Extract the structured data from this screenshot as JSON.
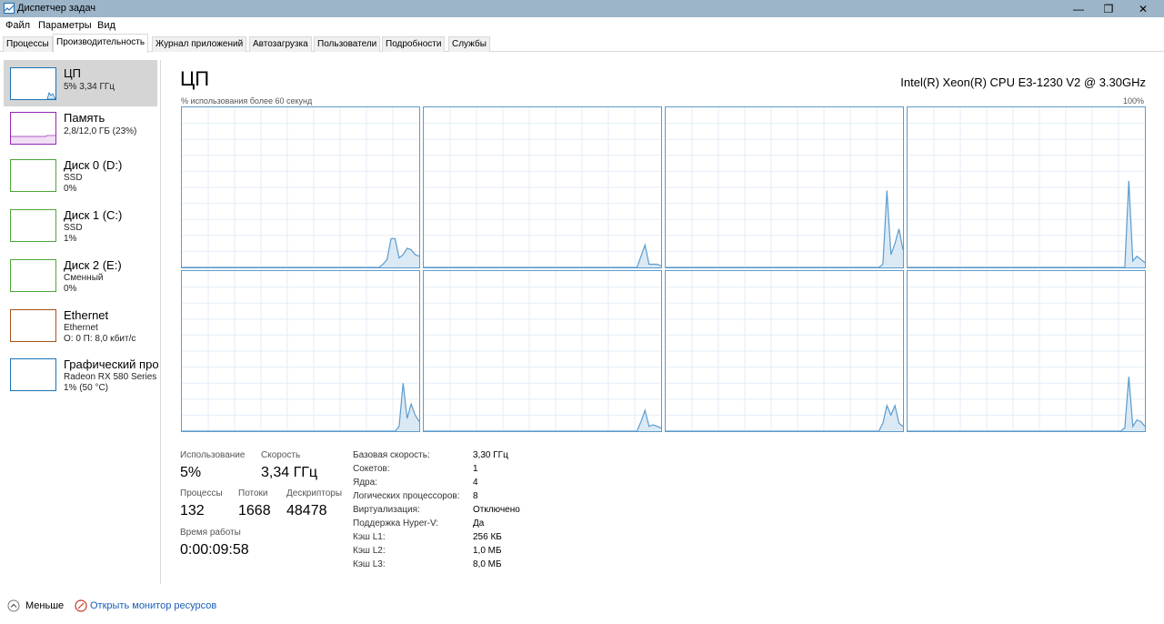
{
  "window": {
    "title": "Диспетчер задач",
    "minimize": "—",
    "maximize": "❐",
    "close": "✕"
  },
  "menu": [
    "Файл",
    "Параметры",
    "Вид"
  ],
  "tabs": [
    "Процессы",
    "Производительность",
    "Журнал приложений",
    "Автозагрузка",
    "Пользователи",
    "Подробности",
    "Службы"
  ],
  "active_tab": 1,
  "sidebar": [
    {
      "name": "ЦП",
      "sub1": "5% 3,34 ГГц",
      "sub2": "",
      "sub3": "",
      "color": "#1874b8",
      "sel": true
    },
    {
      "name": "Память",
      "sub1": "2,8/12,0 ГБ (23%)",
      "sub2": "",
      "sub3": "",
      "color": "#9528b4",
      "sel": false
    },
    {
      "name": "Диск 0 (D:)",
      "sub1": "SSD",
      "sub2": "0%",
      "sub3": "",
      "color": "#4ca637",
      "sel": false
    },
    {
      "name": "Диск 1 (C:)",
      "sub1": "SSD",
      "sub2": "1%",
      "sub3": "",
      "color": "#4ca637",
      "sel": false
    },
    {
      "name": "Диск 2 (E:)",
      "sub1": "Сменный",
      "sub2": "0%",
      "sub3": "",
      "color": "#4ca637",
      "sel": false
    },
    {
      "name": "Ethernet",
      "sub1": "Ethernet",
      "sub2": "О: 0 П: 8,0 кбит/с",
      "sub3": "",
      "color": "#a7541b",
      "sel": false
    },
    {
      "name": "Графический про",
      "sub1": "Radeon RX 580 Series",
      "sub2": "1% (50 °C)",
      "sub3": "",
      "color": "#1874b8",
      "sel": false
    }
  ],
  "main": {
    "title": "ЦП",
    "cpu_name": "Intel(R) Xeon(R) CPU E3-1230 V2 @ 3.30GHz",
    "graph_label": "% использования более 60 секунд",
    "graph_max": "100%",
    "line_color": "#5b9ccd",
    "fill_color": "#dbe9f5"
  },
  "stats": {
    "usage_label": "Использование",
    "usage": "5%",
    "speed_label": "Скорость",
    "speed": "3,34 ГГц",
    "proc_label": "Процессы",
    "proc": "132",
    "threads_label": "Потоки",
    "threads": "1668",
    "handles_label": "Дескрипторы",
    "handles": "48478",
    "uptime_label": "Время работы",
    "uptime": "0:00:09:58"
  },
  "details": [
    {
      "k": "Базовая скорость:",
      "v": "3,30 ГГц"
    },
    {
      "k": "Сокетов:",
      "v": "1"
    },
    {
      "k": "Ядра:",
      "v": "4"
    },
    {
      "k": "Логических процессоров:",
      "v": "8"
    },
    {
      "k": "Виртуализация:",
      "v": "Отключено"
    },
    {
      "k": "Поддержка Hyper-V:",
      "v": "Да"
    },
    {
      "k": "Кэш L1:",
      "v": "256 КБ"
    },
    {
      "k": "Кэш L2:",
      "v": "1,0 МБ"
    },
    {
      "k": "Кэш L3:",
      "v": "8,0 МБ"
    }
  ],
  "footer": {
    "less": "Меньше",
    "monitor": "Открыть монитор ресурсов"
  },
  "cores": [
    [
      0,
      0,
      0,
      0,
      0,
      0,
      0,
      0,
      0,
      0,
      0,
      0,
      0,
      0,
      0,
      0,
      0,
      0,
      0,
      0,
      0,
      0,
      0,
      0,
      0,
      0,
      0,
      0,
      0,
      0,
      0,
      0,
      0,
      0,
      0,
      0,
      0,
      0,
      0,
      0,
      0,
      0,
      0,
      0,
      0,
      0,
      0,
      0,
      0,
      0,
      2,
      5,
      18,
      18,
      6,
      8,
      12,
      11,
      8,
      7
    ],
    [
      0,
      0,
      0,
      0,
      0,
      0,
      0,
      0,
      0,
      0,
      0,
      0,
      0,
      0,
      0,
      0,
      0,
      0,
      0,
      0,
      0,
      0,
      0,
      0,
      0,
      0,
      0,
      0,
      0,
      0,
      0,
      0,
      0,
      0,
      0,
      0,
      0,
      0,
      0,
      0,
      0,
      0,
      0,
      0,
      0,
      0,
      0,
      0,
      0,
      0,
      0,
      0,
      0,
      0,
      7,
      14,
      2,
      2,
      2,
      1
    ],
    [
      0,
      0,
      0,
      0,
      0,
      0,
      0,
      0,
      0,
      0,
      0,
      0,
      0,
      0,
      0,
      0,
      0,
      0,
      0,
      0,
      0,
      0,
      0,
      0,
      0,
      0,
      0,
      0,
      0,
      0,
      0,
      0,
      0,
      0,
      0,
      0,
      0,
      0,
      0,
      0,
      0,
      0,
      0,
      0,
      0,
      0,
      0,
      0,
      0,
      0,
      0,
      0,
      0,
      0,
      2,
      48,
      8,
      15,
      24,
      11
    ],
    [
      0,
      0,
      0,
      0,
      0,
      0,
      0,
      0,
      0,
      0,
      0,
      0,
      0,
      0,
      0,
      0,
      0,
      0,
      0,
      0,
      0,
      0,
      0,
      0,
      0,
      0,
      0,
      0,
      0,
      0,
      0,
      0,
      0,
      0,
      0,
      0,
      0,
      0,
      0,
      0,
      0,
      0,
      0,
      0,
      0,
      0,
      0,
      0,
      0,
      0,
      0,
      0,
      0,
      0,
      0,
      54,
      4,
      7,
      5,
      3
    ],
    [
      0,
      0,
      0,
      0,
      0,
      0,
      0,
      0,
      0,
      0,
      0,
      0,
      0,
      0,
      0,
      0,
      0,
      0,
      0,
      0,
      0,
      0,
      0,
      0,
      0,
      0,
      0,
      0,
      0,
      0,
      0,
      0,
      0,
      0,
      0,
      0,
      0,
      0,
      0,
      0,
      0,
      0,
      0,
      0,
      0,
      0,
      0,
      0,
      0,
      0,
      0,
      0,
      0,
      0,
      3,
      30,
      8,
      17,
      10,
      6
    ],
    [
      0,
      0,
      0,
      0,
      0,
      0,
      0,
      0,
      0,
      0,
      0,
      0,
      0,
      0,
      0,
      0,
      0,
      0,
      0,
      0,
      0,
      0,
      0,
      0,
      0,
      0,
      0,
      0,
      0,
      0,
      0,
      0,
      0,
      0,
      0,
      0,
      0,
      0,
      0,
      0,
      0,
      0,
      0,
      0,
      0,
      0,
      0,
      0,
      0,
      0,
      0,
      0,
      0,
      0,
      6,
      13,
      3,
      4,
      3,
      2
    ],
    [
      0,
      0,
      0,
      0,
      0,
      0,
      0,
      0,
      0,
      0,
      0,
      0,
      0,
      0,
      0,
      0,
      0,
      0,
      0,
      0,
      0,
      0,
      0,
      0,
      0,
      0,
      0,
      0,
      0,
      0,
      0,
      0,
      0,
      0,
      0,
      0,
      0,
      0,
      0,
      0,
      0,
      0,
      0,
      0,
      0,
      0,
      0,
      0,
      0,
      0,
      0,
      0,
      0,
      0,
      5,
      16,
      10,
      16,
      5,
      3
    ],
    [
      0,
      0,
      0,
      0,
      0,
      0,
      0,
      0,
      0,
      0,
      0,
      0,
      0,
      0,
      0,
      0,
      0,
      0,
      0,
      0,
      0,
      0,
      0,
      0,
      0,
      0,
      0,
      0,
      0,
      0,
      0,
      0,
      0,
      0,
      0,
      0,
      0,
      0,
      0,
      0,
      0,
      0,
      0,
      0,
      0,
      0,
      0,
      0,
      0,
      0,
      0,
      0,
      0,
      0,
      2,
      34,
      3,
      7,
      6,
      3
    ]
  ]
}
